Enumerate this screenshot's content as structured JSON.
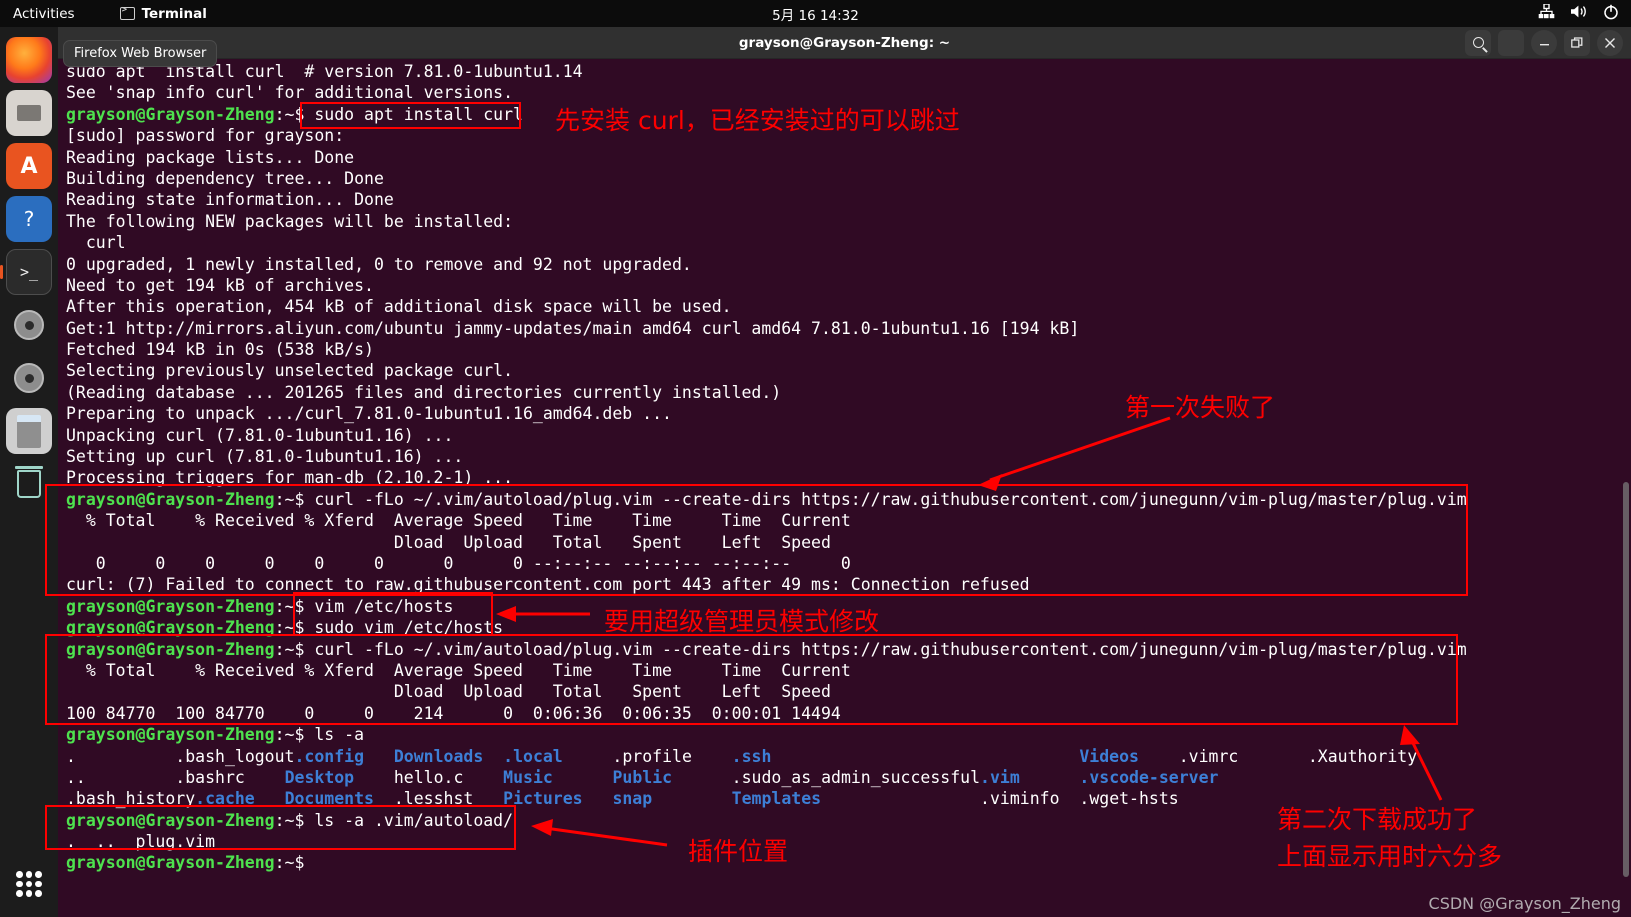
{
  "topbar": {
    "activities": "Activities",
    "app_name": "Terminal",
    "clock": "5月 16  14:32",
    "icons": [
      "network-icon",
      "volume-icon",
      "power-icon"
    ]
  },
  "dock": {
    "tooltip": "Firefox Web Browser",
    "items": [
      {
        "name": "firefox",
        "label": "Firefox Web Browser"
      },
      {
        "name": "files",
        "label": "Files"
      },
      {
        "name": "app-store",
        "label": "Ubuntu Software",
        "glyph": "A"
      },
      {
        "name": "help",
        "label": "Help",
        "glyph": "?"
      },
      {
        "name": "terminal",
        "label": "Terminal",
        "glyph": ">_"
      },
      {
        "name": "disc-1",
        "label": "Disc"
      },
      {
        "name": "disc-2",
        "label": "Disc"
      },
      {
        "name": "calculator",
        "label": "Calculator"
      },
      {
        "name": "trash",
        "label": "Trash"
      }
    ]
  },
  "window": {
    "title": "grayson@Grayson-Zheng: ~",
    "buttons": [
      {
        "name": "search-button",
        "glyph": "search-icon"
      },
      {
        "name": "menu-button",
        "glyph": "hamburger-icon"
      },
      {
        "name": "minimize-button",
        "glyph": "—"
      },
      {
        "name": "maximize-button",
        "glyph": "restore-icon"
      },
      {
        "name": "close-button",
        "glyph": "×"
      }
    ]
  },
  "terminal": {
    "prompt": "grayson@Grayson-Zheng",
    "prompt_tail": ":~$ ",
    "lines": [
      {
        "type": "plain",
        "text": "sudo apt  install curl  # version 7.81.0-1ubuntu1.14"
      },
      {
        "type": "plain",
        "text": "See 'snap info curl' for additional versions."
      },
      {
        "type": "cmd",
        "text": "sudo apt install curl"
      },
      {
        "type": "plain",
        "text": "[sudo] password for grayson:"
      },
      {
        "type": "plain",
        "text": "Reading package lists... Done"
      },
      {
        "type": "plain",
        "text": "Building dependency tree... Done"
      },
      {
        "type": "plain",
        "text": "Reading state information... Done"
      },
      {
        "type": "plain",
        "text": "The following NEW packages will be installed:"
      },
      {
        "type": "plain",
        "text": "  curl"
      },
      {
        "type": "plain",
        "text": "0 upgraded, 1 newly installed, 0 to remove and 92 not upgraded."
      },
      {
        "type": "plain",
        "text": "Need to get 194 kB of archives."
      },
      {
        "type": "plain",
        "text": "After this operation, 454 kB of additional disk space will be used."
      },
      {
        "type": "plain",
        "text": "Get:1 http://mirrors.aliyun.com/ubuntu jammy-updates/main amd64 curl amd64 7.81.0-1ubuntu1.16 [194 kB]"
      },
      {
        "type": "plain",
        "text": "Fetched 194 kB in 0s (538 kB/s)"
      },
      {
        "type": "plain",
        "text": "Selecting previously unselected package curl."
      },
      {
        "type": "plain",
        "text": "(Reading database ... 201265 files and directories currently installed.)"
      },
      {
        "type": "plain",
        "text": "Preparing to unpack .../curl_7.81.0-1ubuntu1.16_amd64.deb ..."
      },
      {
        "type": "plain",
        "text": "Unpacking curl (7.81.0-1ubuntu1.16) ..."
      },
      {
        "type": "plain",
        "text": "Setting up curl (7.81.0-1ubuntu1.16) ..."
      },
      {
        "type": "plain",
        "text": "Processing triggers for man-db (2.10.2-1) ..."
      },
      {
        "type": "cmd",
        "text": "curl -fLo ~/.vim/autoload/plug.vim --create-dirs https://raw.githubusercontent.com/junegunn/vim-plug/master/plug.vim"
      },
      {
        "type": "plain",
        "text": "  % Total    % Received % Xferd  Average Speed   Time    Time     Time  Current"
      },
      {
        "type": "plain",
        "text": "                                 Dload  Upload   Total   Spent    Left  Speed"
      },
      {
        "type": "plain",
        "text": "   0     0    0     0    0     0      0      0 --:--:-- --:--:-- --:--:--     0"
      },
      {
        "type": "plain",
        "text": "curl: (7) Failed to connect to raw.githubusercontent.com port 443 after 49 ms: Connection refused"
      },
      {
        "type": "cmd",
        "text": "vim /etc/hosts"
      },
      {
        "type": "cmd",
        "text": "sudo vim /etc/hosts"
      },
      {
        "type": "cmd",
        "text": "curl -fLo ~/.vim/autoload/plug.vim --create-dirs https://raw.githubusercontent.com/junegunn/vim-plug/master/plug.vim"
      },
      {
        "type": "plain",
        "text": "  % Total    % Received % Xferd  Average Speed   Time    Time     Time  Current"
      },
      {
        "type": "plain",
        "text": "                                 Dload  Upload   Total   Spent    Left  Speed"
      },
      {
        "type": "plain",
        "text": "100 84770  100 84770    0     0    214      0  0:06:36  0:06:35  0:00:01 14494"
      },
      {
        "type": "cmd",
        "text": "ls -a"
      },
      {
        "type": "ls1"
      },
      {
        "type": "ls2"
      },
      {
        "type": "ls3"
      },
      {
        "type": "cmd",
        "text": "ls -a .vim/autoload/"
      },
      {
        "type": "plain",
        "text": ".  ..  plug.vim"
      },
      {
        "type": "cmd",
        "text": ""
      }
    ],
    "ls_rows": [
      [
        {
          "t": ".",
          "c": "white"
        },
        {
          "t": ".bash_logout",
          "c": "white"
        },
        {
          "t": ".config",
          "c": "blue"
        },
        {
          "t": "Downloads",
          "c": "blue"
        },
        {
          "t": ".local",
          "c": "blue"
        },
        {
          "t": ".profile",
          "c": "white"
        },
        {
          "t": ".ssh",
          "c": "blue"
        },
        {
          "t": "",
          "c": "white"
        },
        {
          "t": "Videos",
          "c": "blue"
        },
        {
          "t": ".vimrc",
          "c": "white"
        },
        {
          "t": ".Xauthority",
          "c": "white"
        }
      ],
      [
        {
          "t": "..",
          "c": "white"
        },
        {
          "t": ".bashrc",
          "c": "white"
        },
        {
          "t": "Desktop",
          "c": "blue"
        },
        {
          "t": "hello.c",
          "c": "white"
        },
        {
          "t": "Music",
          "c": "blue"
        },
        {
          "t": "Public",
          "c": "blue"
        },
        {
          "t": ".sudo_as_admin_successful",
          "c": "white"
        },
        {
          "t": ".vim",
          "c": "blue"
        },
        {
          "t": ".vscode-server",
          "c": "blue"
        },
        {
          "t": "",
          "c": "white"
        },
        {
          "t": "",
          "c": "white"
        }
      ],
      [
        {
          "t": ".bash_history",
          "c": "white"
        },
        {
          "t": ".cache",
          "c": "blue"
        },
        {
          "t": "Documents",
          "c": "blue"
        },
        {
          "t": ".lesshst",
          "c": "white"
        },
        {
          "t": "Pictures",
          "c": "blue"
        },
        {
          "t": "snap",
          "c": "blue"
        },
        {
          "t": "Templates",
          "c": "blue"
        },
        {
          "t": ".viminfo",
          "c": "white"
        },
        {
          "t": ".wget-hsts",
          "c": "white"
        },
        {
          "t": "",
          "c": "white"
        },
        {
          "t": "",
          "c": "white"
        }
      ]
    ]
  },
  "annotations": {
    "install_curl": "先安装 curl，已经安装过的可以跳过",
    "first_fail": "第一次失败了",
    "need_sudo": "要用超级管理员模式修改",
    "second_ok_line1": "第二次下载成功了",
    "second_ok_line2": "上面显示用时六分多",
    "plugin_location": "插件位置",
    "watermark": "CSDN @Grayson_Zheng"
  },
  "colors": {
    "terminal_bg": "#300a24",
    "annotation_red": "#fe0000",
    "prompt_green": "#4ee24e",
    "dir_blue": "#3d7fd6",
    "accent_orange": "#e95420"
  }
}
